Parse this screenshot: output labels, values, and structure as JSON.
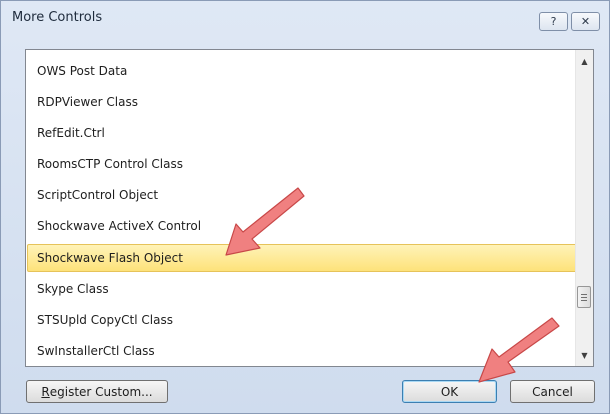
{
  "dialog": {
    "title": "More Controls",
    "help_glyph": "?",
    "close_glyph": "✕"
  },
  "list": {
    "items": [
      "OWS Post Data",
      "RDPViewer Class",
      "RefEdit.Ctrl",
      "RoomsCTP Control Class",
      "ScriptControl Object",
      "Shockwave ActiveX Control",
      "Shockwave Flash Object",
      "Skype Class",
      "STSUpld CopyCtl Class",
      "SwInstallerCtl Class"
    ],
    "selected": "Shockwave Flash Object"
  },
  "scrollbar": {
    "up_glyph": "▲",
    "down_glyph": "▼"
  },
  "buttons": {
    "register_first": "R",
    "register_rest": "egister Custom...",
    "ok": "OK",
    "cancel": "Cancel"
  },
  "colors": {
    "selection": "#fde27a",
    "annotation_arrow": "#f08080",
    "dialog_frame": "#cfdcee"
  },
  "icons": {
    "help": "help-icon",
    "close": "close-icon",
    "annotation": "red-arrow-icon"
  }
}
